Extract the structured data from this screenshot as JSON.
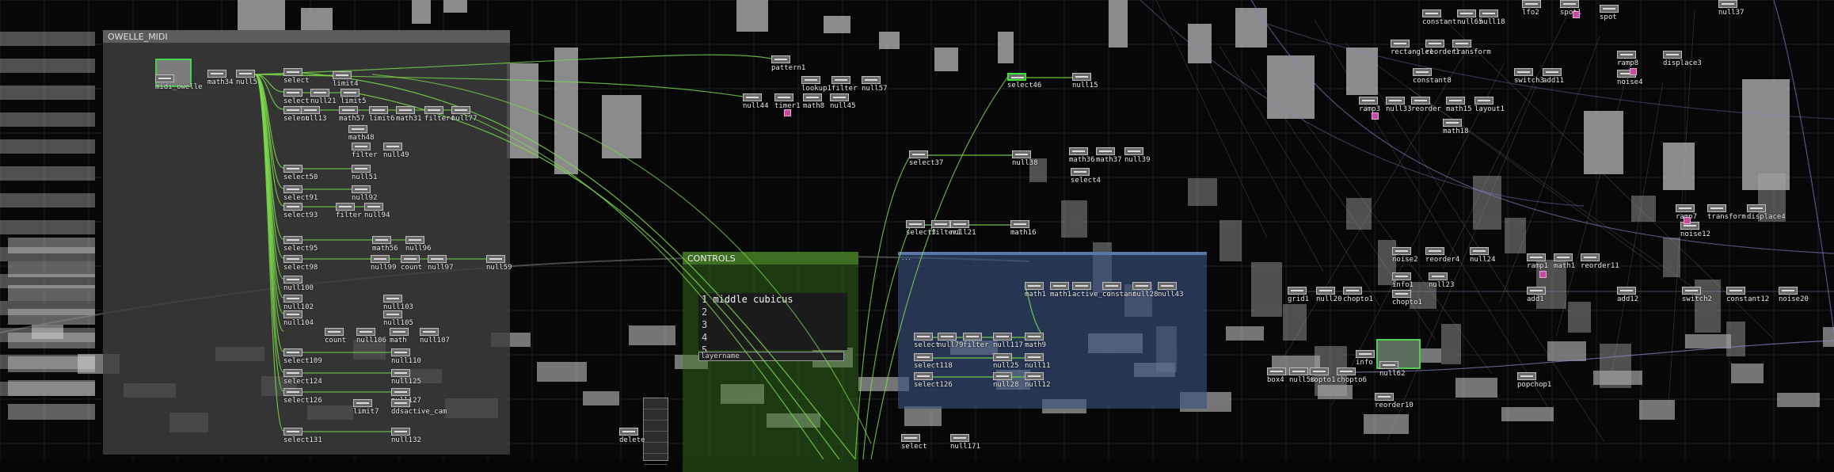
{
  "panels": {
    "owelle": {
      "title": "OWELLE_MIDI"
    },
    "controls": {
      "title": "CONTROLS",
      "list": [
        "1 middle cubicus",
        "2",
        "3",
        "4",
        "5"
      ],
      "field": "layername"
    },
    "blue": {
      "title": "..."
    }
  },
  "nodes": {
    "midi": "midi_owelle",
    "math34": "math34",
    "null5": "null5",
    "limit4": "limit4",
    "select_a": "select",
    "select_b": "select",
    "limit5": "limit5",
    "null21": "null21",
    "select_c": "select",
    "math57": "math57",
    "limit6": "limit6",
    "math31": "math31",
    "filter4": "filter4",
    "null77": "null77",
    "null13": "null13",
    "math48": "math48",
    "filter": "filter",
    "null49": "null49",
    "select50": "select50",
    "null51": "null51",
    "select91": "select91",
    "null92": "null92",
    "select93": "select93",
    "filter_b": "filter",
    "null94": "null94",
    "select95": "select95",
    "math56": "math56",
    "null96": "null96",
    "select98": "select98",
    "null99": "null99",
    "count": "count",
    "null97": "null97",
    "null59": "null59",
    "null100": "null100",
    "null102": "null102",
    "null103": "null103",
    "null104": "null104",
    "null105": "null105",
    "count2": "count",
    "null106": "null106",
    "math": "math",
    "null107": "null107",
    "select109": "select109",
    "null110": "null110",
    "select124": "select124",
    "null125": "null125",
    "select126": "select126",
    "null127": "null127",
    "limit7": "limit7",
    "ddsactive_cam": "ddsactive_cam",
    "select131": "select131",
    "null132": "null132",
    "pattern1": "pattern1",
    "null44": "null44",
    "timer1": "timer1",
    "lookup1": "lookup1",
    "filter1": "filter",
    "null57": "null57",
    "math8": "math8",
    "null45": "null45",
    "select46": "select46",
    "null15": "null15",
    "select37": "select37",
    "null38": "null38",
    "math36": "math36",
    "math37": "math37",
    "null39": "null39",
    "select4": "select4",
    "select3": "select3",
    "filter1b": "filter1",
    "null21b": "null21",
    "math16": "math16",
    "math_b1": "math1",
    "math_b2": "math1",
    "active_ca": "active_ca",
    "constant": "constant",
    "null28": "null28",
    "null43": "null43",
    "select_b3": "select",
    "null79": "null79",
    "filter_b2": "filter",
    "null117": "null117",
    "math9": "math9",
    "select118": "select118",
    "null25": "null25",
    "null11": "null11",
    "select126b": "select126",
    "null28b": "null28",
    "null12": "null12",
    "select_b4": "select",
    "null171": "null171",
    "delete": "delete",
    "constant_r": "constant",
    "null65": "null65",
    "null18": "null18",
    "rectangle1": "rectangle1",
    "reorder1": "reorder1",
    "transform": "transform",
    "constant8": "constant8",
    "switch3": "switch3",
    "add11": "add11",
    "ramp3": "ramp3",
    "null33": "null33",
    "reorder": "reorder",
    "math15": "math15",
    "layout1": "layout1",
    "math18": "math18",
    "ramp8": "ramp8",
    "displace3": "displace3",
    "noise4": "noise4",
    "lfo2": "lfo2",
    "spot1": "spot1",
    "spot": "spot",
    "null37": "null37",
    "ramp7": "ramp7",
    "transform2": "transform",
    "displace4": "displace4",
    "noise12": "noise12",
    "noise2": "noise2",
    "reorder4": "reorder4",
    "null24": "null24",
    "ramp1": "ramp1",
    "math1": "math1",
    "reorder11": "reorder11",
    "info1": "info1",
    "null23": "null23",
    "grid1": "grid1",
    "null20": "null20",
    "chopto1": "chopto1",
    "chopto1b": "chopto1",
    "add1": "add1",
    "add12": "add12",
    "switch2": "switch2",
    "constant12": "constant12",
    "noise20": "noise20",
    "info": "info",
    "null62": "null62",
    "box4": "box4",
    "null58": "null58",
    "sopto1": "sopto1",
    "chopto6": "chopto6",
    "reorder10": "reorder10",
    "popchop1": "popchop1"
  },
  "colors": {
    "accent_green": "#48d24a",
    "controls_green": "#3d6e22",
    "blue_panel": "#3a5280",
    "flag": "#c54aa0"
  }
}
